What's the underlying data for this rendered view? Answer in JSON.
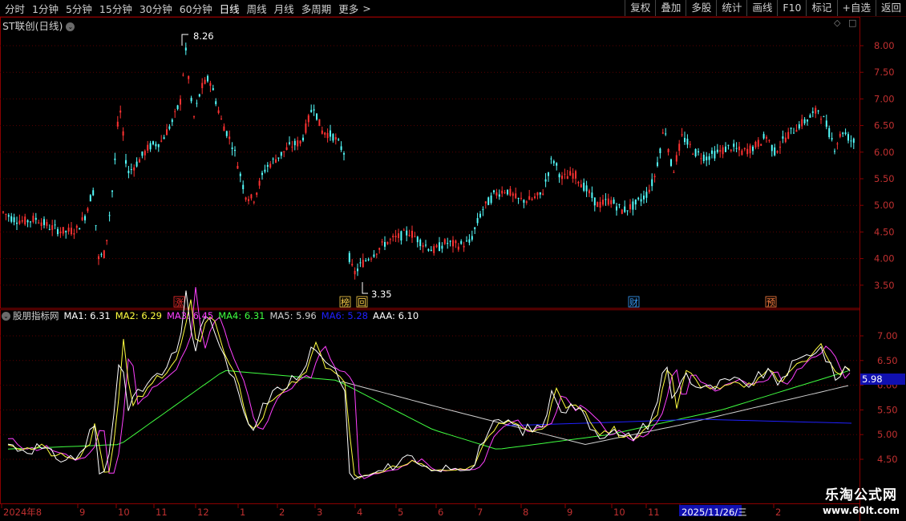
{
  "toolbar": {
    "periods": [
      "分时",
      "1分钟",
      "5分钟",
      "15分钟",
      "30分钟",
      "60分钟",
      "日线",
      "周线",
      "月线",
      "多周期",
      "更多"
    ],
    "active_period": "日线",
    "more_arrow": ">",
    "buttons": [
      "复权",
      "叠加",
      "多股",
      "统计",
      "画线",
      "F10",
      "标记",
      "+自选",
      "返回"
    ]
  },
  "main_chart": {
    "title": "ST联创(日线)",
    "high_label": "8.26",
    "low_label": "3.35",
    "price_ticks": [
      "8.00",
      "7.50",
      "7.00",
      "6.50",
      "6.00",
      "5.50",
      "5.00",
      "4.50",
      "4.00",
      "3.50"
    ],
    "event_markers": [
      {
        "text": "涨",
        "color": "#ff3030"
      },
      {
        "text": "榜",
        "color": "#ffd24a"
      },
      {
        "text": "回",
        "color": "#ffd24a"
      },
      {
        "text": "财",
        "color": "#3aa0ff"
      },
      {
        "text": "预",
        "color": "#ff8040"
      }
    ]
  },
  "indicator": {
    "name": "股朋指标网",
    "values": [
      {
        "label": "MA1: 6.31",
        "color": "#ffffff"
      },
      {
        "label": "MA2: 6.29",
        "color": "#ffff40"
      },
      {
        "label": "MA3: 6.45",
        "color": "#ff40ff"
      },
      {
        "label": "MA4: 6.31",
        "color": "#40ff40"
      },
      {
        "label": "MA5: 5.96",
        "color": "#d0d0d0"
      },
      {
        "label": "MA6: 5.28",
        "color": "#2020ff"
      },
      {
        "label": "AAA: 6.10",
        "color": "#ffffff"
      }
    ],
    "ticks": [
      "7.00",
      "6.50",
      "6.00",
      "5.50",
      "5.00",
      "4.50"
    ],
    "current_badge": "5.98"
  },
  "time_axis": {
    "labels": [
      "2024年8",
      "9",
      "10",
      "11",
      "12",
      "1",
      "2",
      "3",
      "4",
      "5",
      "6",
      "7",
      "8",
      "9",
      "10",
      "11",
      "2025/11/26/三",
      "2"
    ]
  },
  "watermark": {
    "line1": "乐淘公式网",
    "line2": "www.60lt.com"
  },
  "colors": {
    "up": "#ff3232",
    "down": "#54fcfc",
    "grid": "#5a0000",
    "axis_text": "#c03030"
  }
}
